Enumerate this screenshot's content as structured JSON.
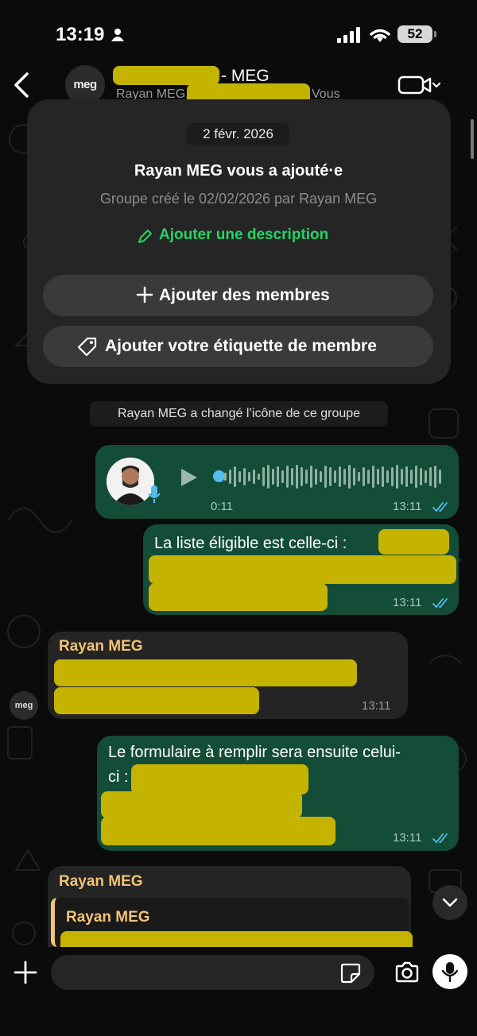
{
  "status_bar": {
    "time": "13:19",
    "battery": "52"
  },
  "header": {
    "group_avatar_text": "meg",
    "title_suffix": "- MEG",
    "subtitle_start": "Rayan MEG,",
    "subtitle_end": "Vous"
  },
  "group_info": {
    "date": "2 févr. 2026",
    "title": "Rayan MEG vous a ajouté·e",
    "created": "Groupe créé le 02/02/2026 par Rayan MEG",
    "add_description": "Ajouter une description",
    "add_members": "Ajouter des membres",
    "add_tag": "Ajouter votre étiquette de membre"
  },
  "system_note": "Rayan MEG a changé l’icône de ce groupe",
  "messages": [
    {
      "type": "voice",
      "direction": "out",
      "duration": "0:11",
      "time": "13:11"
    },
    {
      "type": "text",
      "direction": "out",
      "text": "La liste éligible est celle-ci :",
      "time": "13:11"
    },
    {
      "type": "text",
      "direction": "in",
      "sender": "Rayan MEG",
      "time": "13:11"
    },
    {
      "type": "text",
      "direction": "out",
      "text_line1": "Le formulaire à remplir sera ensuite celui-",
      "text_line2": "ci :",
      "time": "13:11"
    },
    {
      "type": "text",
      "direction": "in",
      "sender": "Rayan MEG",
      "reply_sender": "Rayan MEG"
    }
  ],
  "input_bar": {
    "placeholder": ""
  },
  "colors": {
    "outgoing": "#144d37",
    "incoming": "#242424",
    "accent": "#25d366",
    "sender": "#f3c373",
    "read_ticks": "#53bdeb"
  }
}
